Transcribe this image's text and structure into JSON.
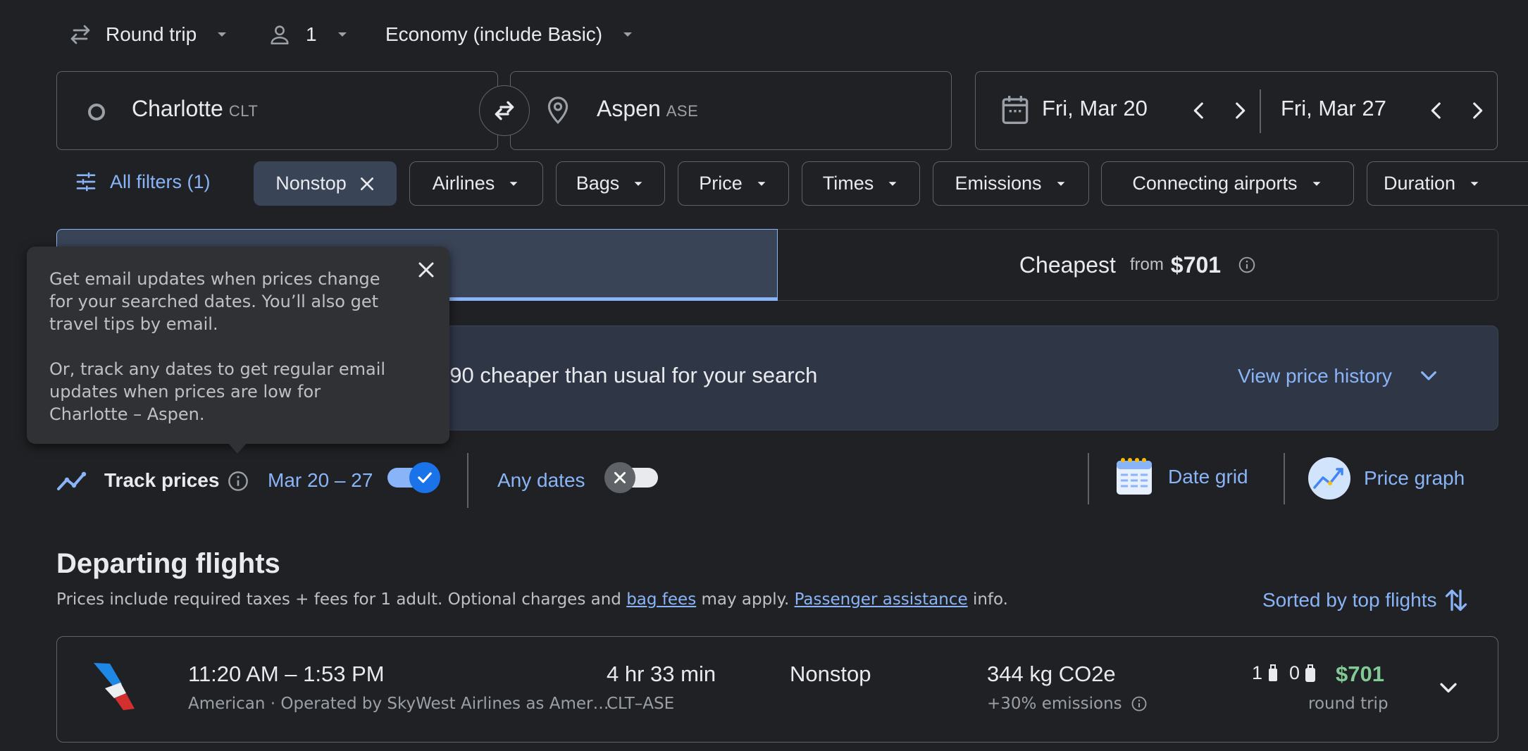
{
  "top": {
    "trip_type": "Round trip",
    "passengers": "1",
    "cabin": "Economy (include Basic)"
  },
  "search": {
    "origin_city": "Charlotte",
    "origin_code": "CLT",
    "dest_city": "Aspen",
    "dest_code": "ASE",
    "depart_date": "Fri, Mar 20",
    "return_date": "Fri, Mar 27"
  },
  "filters": {
    "all_filters": "All filters (1)",
    "chips": [
      "Nonstop",
      "Airlines",
      "Bags",
      "Price",
      "Times",
      "Emissions",
      "Connecting airports",
      "Duration"
    ]
  },
  "tabs": {
    "cheapest_label": "Cheapest",
    "cheapest_from": "from",
    "cheapest_price": "$701"
  },
  "insight": {
    "text_visible": "590 cheaper than usual for your search",
    "view_history": "View price history"
  },
  "tooltip": {
    "para1": "Get email updates when prices change for your searched dates. You’ll also get travel tips by email.",
    "para2": "Or, track any dates to get regular email updates when prices are low for Charlotte – Aspen."
  },
  "tracking": {
    "track_prices": "Track prices",
    "dates": "Mar 20 – 27",
    "any_dates": "Any dates",
    "date_grid": "Date grid",
    "price_graph": "Price graph"
  },
  "departing": {
    "title": "Departing flights",
    "disclaimer_start": "Prices include required taxes + fees for 1 adult. Optional charges and ",
    "bag_fees": "bag fees",
    "disclaimer_mid": " may apply. ",
    "passenger_assistance": "Passenger assistance",
    "disclaimer_end": " info.",
    "sort_label": "Sorted by top flights"
  },
  "flights": [
    {
      "times": "11:20 AM – 1:53 PM",
      "airline": "American · Operated by SkyWest Airlines as Amer…",
      "duration": "4 hr 33 min",
      "route": "CLT–ASE",
      "stops": "Nonstop",
      "emissions": "344 kg CO2e",
      "emissions_delta": "+30% emissions",
      "carry_on": "1",
      "checked": "0",
      "price": "$701",
      "price_type": "round trip"
    }
  ],
  "colors": {
    "background": "#202124",
    "accent": "#8ab4f8",
    "price_green": "#81c995",
    "selected_tab": "#394457",
    "insight_bg": "#2f3747"
  }
}
